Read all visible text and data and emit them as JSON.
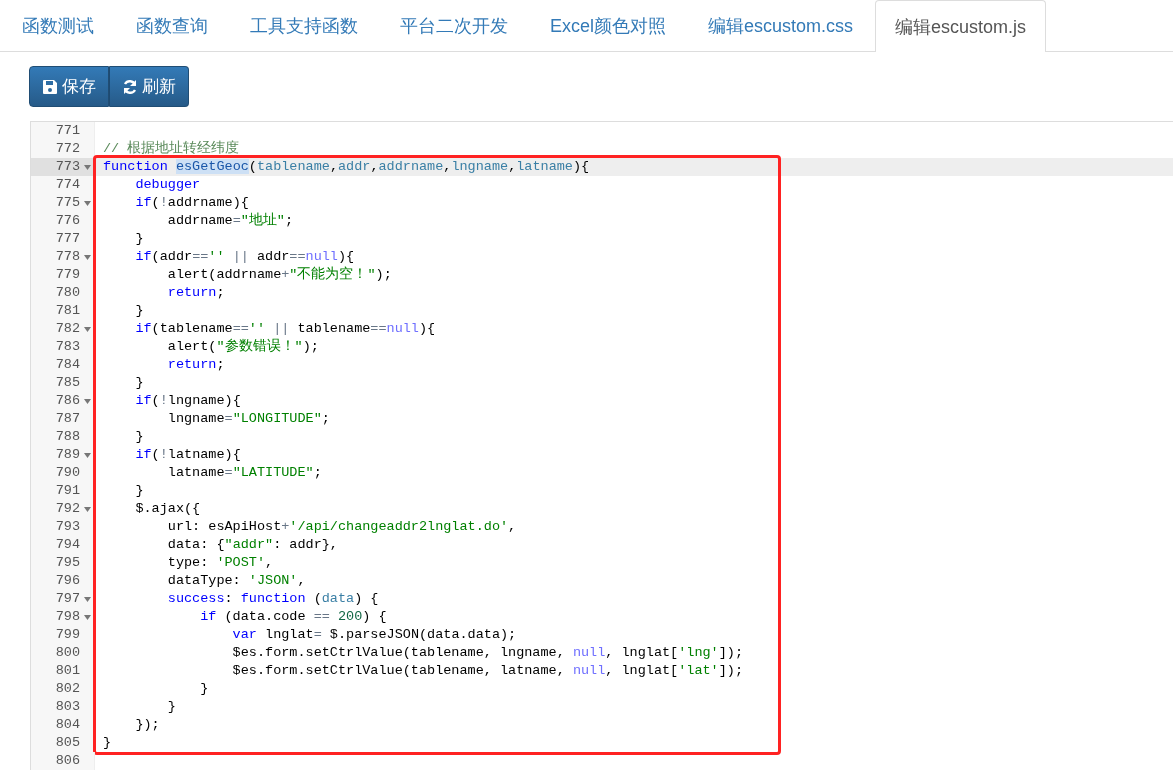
{
  "tabs": [
    {
      "label": "函数测试",
      "selected": false
    },
    {
      "label": "函数查询",
      "selected": false
    },
    {
      "label": "工具支持函数",
      "selected": false
    },
    {
      "label": "平台二次开发",
      "selected": false
    },
    {
      "label": "Excel颜色对照",
      "selected": false
    },
    {
      "label": "编辑escustom.css",
      "selected": false
    },
    {
      "label": "编辑escustom.js",
      "selected": true
    }
  ],
  "toolbar": [
    {
      "kind": "save",
      "label": "保存"
    },
    {
      "kind": "refresh",
      "label": "刷新"
    }
  ],
  "editor": {
    "sections": [
      {
        "framed": false,
        "lines": [
          {
            "number": "771",
            "foldable": false,
            "active": false
          },
          {
            "number": "772",
            "foldable": false,
            "active": false,
            "tokens": [
              {
                "kind": "comment",
                "text": "// 根据地址转经纬度"
              }
            ]
          }
        ]
      },
      {
        "framed": true,
        "lines": [
          {
            "number": "773",
            "foldable": true,
            "active": true,
            "tokens": [
              {
                "kind": "keyword",
                "text": "function "
              },
              {
                "kind": "match",
                "text": "esGetGeoc"
              },
              {
                "kind": "plain",
                "text": "("
              },
              {
                "kind": "param",
                "text": "tablename"
              },
              {
                "kind": "plain",
                "text": ","
              },
              {
                "kind": "param",
                "text": "addr"
              },
              {
                "kind": "plain",
                "text": ","
              },
              {
                "kind": "param",
                "text": "addrname"
              },
              {
                "kind": "plain",
                "text": ","
              },
              {
                "kind": "param",
                "text": "lngname"
              },
              {
                "kind": "plain",
                "text": ","
              },
              {
                "kind": "param",
                "text": "latname"
              },
              {
                "kind": "plain",
                "text": "){"
              }
            ]
          },
          {
            "number": "774",
            "foldable": false,
            "active": false,
            "tokens": [
              {
                "kind": "keyword",
                "text": "    debugger"
              }
            ]
          },
          {
            "number": "775",
            "foldable": true,
            "active": false,
            "tokens": [
              {
                "kind": "keyword",
                "text": "    if"
              },
              {
                "kind": "plain",
                "text": "("
              },
              {
                "kind": "operator",
                "text": "!"
              },
              {
                "kind": "plain",
                "text": "addrname){"
              }
            ]
          },
          {
            "number": "776",
            "foldable": false,
            "active": false,
            "tokens": [
              {
                "kind": "plain",
                "text": "        addrname"
              },
              {
                "kind": "operator",
                "text": "="
              },
              {
                "kind": "string",
                "text": "\"地址\""
              },
              {
                "kind": "plain",
                "text": ";"
              }
            ]
          },
          {
            "number": "777",
            "foldable": false,
            "active": false,
            "tokens": [
              {
                "kind": "plain",
                "text": "    }"
              }
            ]
          },
          {
            "number": "778",
            "foldable": true,
            "active": false,
            "tokens": [
              {
                "kind": "keyword",
                "text": "    if"
              },
              {
                "kind": "plain",
                "text": "(addr"
              },
              {
                "kind": "operator",
                "text": "=="
              },
              {
                "kind": "string",
                "text": "'' "
              },
              {
                "kind": "operator",
                "text": "||"
              },
              {
                "kind": "plain",
                "text": " addr"
              },
              {
                "kind": "operator",
                "text": "=="
              },
              {
                "kind": "atom",
                "text": "null"
              },
              {
                "kind": "plain",
                "text": "){"
              }
            ]
          },
          {
            "number": "779",
            "foldable": false,
            "active": false,
            "tokens": [
              {
                "kind": "plain",
                "text": "        alert(addrname"
              },
              {
                "kind": "operator",
                "text": "+"
              },
              {
                "kind": "string",
                "text": "\"不能为空！\""
              },
              {
                "kind": "plain",
                "text": ");"
              }
            ]
          },
          {
            "number": "780",
            "foldable": false,
            "active": false,
            "tokens": [
              {
                "kind": "keyword",
                "text": "        return"
              },
              {
                "kind": "plain",
                "text": ";"
              }
            ]
          },
          {
            "number": "781",
            "foldable": false,
            "active": false,
            "tokens": [
              {
                "kind": "plain",
                "text": "    }"
              }
            ]
          },
          {
            "number": "782",
            "foldable": true,
            "active": false,
            "tokens": [
              {
                "kind": "keyword",
                "text": "    if"
              },
              {
                "kind": "plain",
                "text": "(tablename"
              },
              {
                "kind": "operator",
                "text": "=="
              },
              {
                "kind": "string",
                "text": "'' "
              },
              {
                "kind": "operator",
                "text": "||"
              },
              {
                "kind": "plain",
                "text": " tablename"
              },
              {
                "kind": "operator",
                "text": "=="
              },
              {
                "kind": "atom",
                "text": "null"
              },
              {
                "kind": "plain",
                "text": "){"
              }
            ]
          },
          {
            "number": "783",
            "foldable": false,
            "active": false,
            "tokens": [
              {
                "kind": "plain",
                "text": "        alert("
              },
              {
                "kind": "string",
                "text": "\"参数错误！\""
              },
              {
                "kind": "plain",
                "text": ");"
              }
            ]
          },
          {
            "number": "784",
            "foldable": false,
            "active": false,
            "tokens": [
              {
                "kind": "keyword",
                "text": "        return"
              },
              {
                "kind": "plain",
                "text": ";"
              }
            ]
          },
          {
            "number": "785",
            "foldable": false,
            "active": false,
            "tokens": [
              {
                "kind": "plain",
                "text": "    }"
              }
            ]
          },
          {
            "number": "786",
            "foldable": true,
            "active": false,
            "tokens": [
              {
                "kind": "keyword",
                "text": "    if"
              },
              {
                "kind": "plain",
                "text": "("
              },
              {
                "kind": "operator",
                "text": "!"
              },
              {
                "kind": "plain",
                "text": "lngname){"
              }
            ]
          },
          {
            "number": "787",
            "foldable": false,
            "active": false,
            "tokens": [
              {
                "kind": "plain",
                "text": "        lngname"
              },
              {
                "kind": "operator",
                "text": "="
              },
              {
                "kind": "string",
                "text": "\"LONGITUDE\""
              },
              {
                "kind": "plain",
                "text": ";"
              }
            ]
          },
          {
            "number": "788",
            "foldable": false,
            "active": false,
            "tokens": [
              {
                "kind": "plain",
                "text": "    }"
              }
            ]
          },
          {
            "number": "789",
            "foldable": true,
            "active": false,
            "tokens": [
              {
                "kind": "keyword",
                "text": "    if"
              },
              {
                "kind": "plain",
                "text": "("
              },
              {
                "kind": "operator",
                "text": "!"
              },
              {
                "kind": "plain",
                "text": "latname){"
              }
            ]
          },
          {
            "number": "790",
            "foldable": false,
            "active": false,
            "tokens": [
              {
                "kind": "plain",
                "text": "        latname"
              },
              {
                "kind": "operator",
                "text": "="
              },
              {
                "kind": "string",
                "text": "\"LATITUDE\""
              },
              {
                "kind": "plain",
                "text": ";"
              }
            ]
          },
          {
            "number": "791",
            "foldable": false,
            "active": false,
            "tokens": [
              {
                "kind": "plain",
                "text": "    }"
              }
            ]
          },
          {
            "number": "792",
            "foldable": true,
            "active": false,
            "tokens": [
              {
                "kind": "plain",
                "text": "    $.ajax({"
              }
            ]
          },
          {
            "number": "793",
            "foldable": false,
            "active": false,
            "tokens": [
              {
                "kind": "plain",
                "text": "        url: esApiHost"
              },
              {
                "kind": "operator",
                "text": "+"
              },
              {
                "kind": "string",
                "text": "'/api/changeaddr2lnglat.do'"
              },
              {
                "kind": "plain",
                "text": ","
              }
            ]
          },
          {
            "number": "794",
            "foldable": false,
            "active": false,
            "tokens": [
              {
                "kind": "plain",
                "text": "        data: {"
              },
              {
                "kind": "string",
                "text": "\"addr\""
              },
              {
                "kind": "plain",
                "text": ": addr},"
              }
            ]
          },
          {
            "number": "795",
            "foldable": false,
            "active": false,
            "tokens": [
              {
                "kind": "plain",
                "text": "        type: "
              },
              {
                "kind": "string",
                "text": "'POST'"
              },
              {
                "kind": "plain",
                "text": ","
              }
            ]
          },
          {
            "number": "796",
            "foldable": false,
            "active": false,
            "tokens": [
              {
                "kind": "plain",
                "text": "        dataType: "
              },
              {
                "kind": "string",
                "text": "'JSON'"
              },
              {
                "kind": "plain",
                "text": ","
              }
            ]
          },
          {
            "number": "797",
            "foldable": true,
            "active": false,
            "tokens": [
              {
                "kind": "keyword",
                "text": "        success"
              },
              {
                "kind": "plain",
                "text": ": "
              },
              {
                "kind": "keyword",
                "text": "function"
              },
              {
                "kind": "plain",
                "text": " ("
              },
              {
                "kind": "param",
                "text": "data"
              },
              {
                "kind": "plain",
                "text": ") {"
              }
            ]
          },
          {
            "number": "798",
            "foldable": true,
            "active": false,
            "tokens": [
              {
                "kind": "keyword",
                "text": "            if"
              },
              {
                "kind": "plain",
                "text": " (data.code "
              },
              {
                "kind": "operator",
                "text": "=="
              },
              {
                "kind": "number",
                "text": " 200"
              },
              {
                "kind": "plain",
                "text": ") {"
              }
            ]
          },
          {
            "number": "799",
            "foldable": false,
            "active": false,
            "tokens": [
              {
                "kind": "keyword",
                "text": "                var"
              },
              {
                "kind": "plain",
                "text": " lnglat"
              },
              {
                "kind": "operator",
                "text": "="
              },
              {
                "kind": "plain",
                "text": " $.parseJSON(data.data);"
              }
            ]
          },
          {
            "number": "800",
            "foldable": false,
            "active": false,
            "tokens": [
              {
                "kind": "plain",
                "text": "                $es.form.setCtrlValue(tablename, lngname, "
              },
              {
                "kind": "atom",
                "text": "null"
              },
              {
                "kind": "plain",
                "text": ", lnglat["
              },
              {
                "kind": "string",
                "text": "'lng'"
              },
              {
                "kind": "plain",
                "text": "]);"
              }
            ]
          },
          {
            "number": "801",
            "foldable": false,
            "active": false,
            "tokens": [
              {
                "kind": "plain",
                "text": "                $es.form.setCtrlValue(tablename, latname, "
              },
              {
                "kind": "atom",
                "text": "null"
              },
              {
                "kind": "plain",
                "text": ", lnglat["
              },
              {
                "kind": "string",
                "text": "'lat'"
              },
              {
                "kind": "plain",
                "text": "]);"
              }
            ]
          },
          {
            "number": "802",
            "foldable": false,
            "active": false,
            "tokens": [
              {
                "kind": "plain",
                "text": "            }"
              }
            ]
          },
          {
            "number": "803",
            "foldable": false,
            "active": false,
            "tokens": [
              {
                "kind": "plain",
                "text": "        }"
              }
            ]
          },
          {
            "number": "804",
            "foldable": false,
            "active": false,
            "tokens": [
              {
                "kind": "plain",
                "text": "    });"
              }
            ]
          },
          {
            "number": "805",
            "foldable": false,
            "active": false,
            "tokens": [
              {
                "kind": "plain",
                "text": "}"
              }
            ]
          }
        ]
      },
      {
        "framed": false,
        "lines": [
          {
            "number": "806",
            "foldable": false,
            "active": false
          }
        ]
      }
    ]
  }
}
